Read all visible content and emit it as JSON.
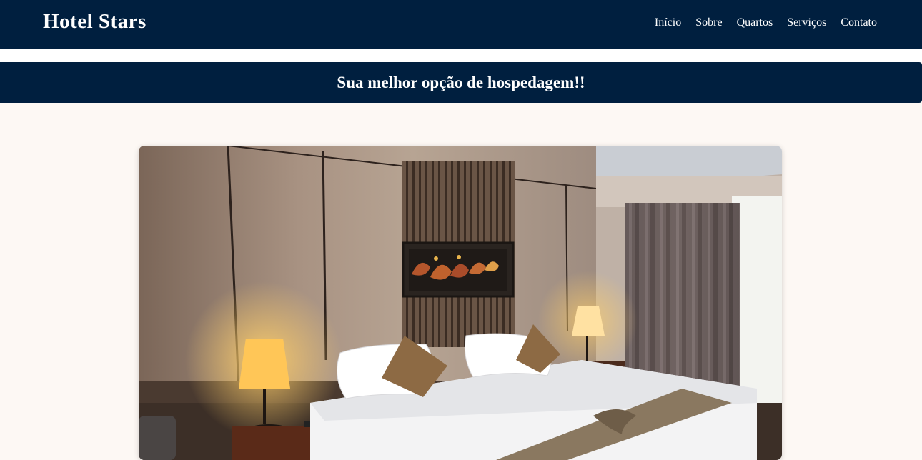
{
  "navbar": {
    "brand": "Hotel Stars",
    "links": [
      {
        "label": "Início"
      },
      {
        "label": "Sobre"
      },
      {
        "label": "Quartos"
      },
      {
        "label": "Serviços"
      },
      {
        "label": "Contato"
      }
    ]
  },
  "banner": {
    "headline": "Sua melhor opção de hospedagem!!"
  },
  "colors": {
    "navy": "#001f3f",
    "page_bg": "#fdf8f4"
  }
}
